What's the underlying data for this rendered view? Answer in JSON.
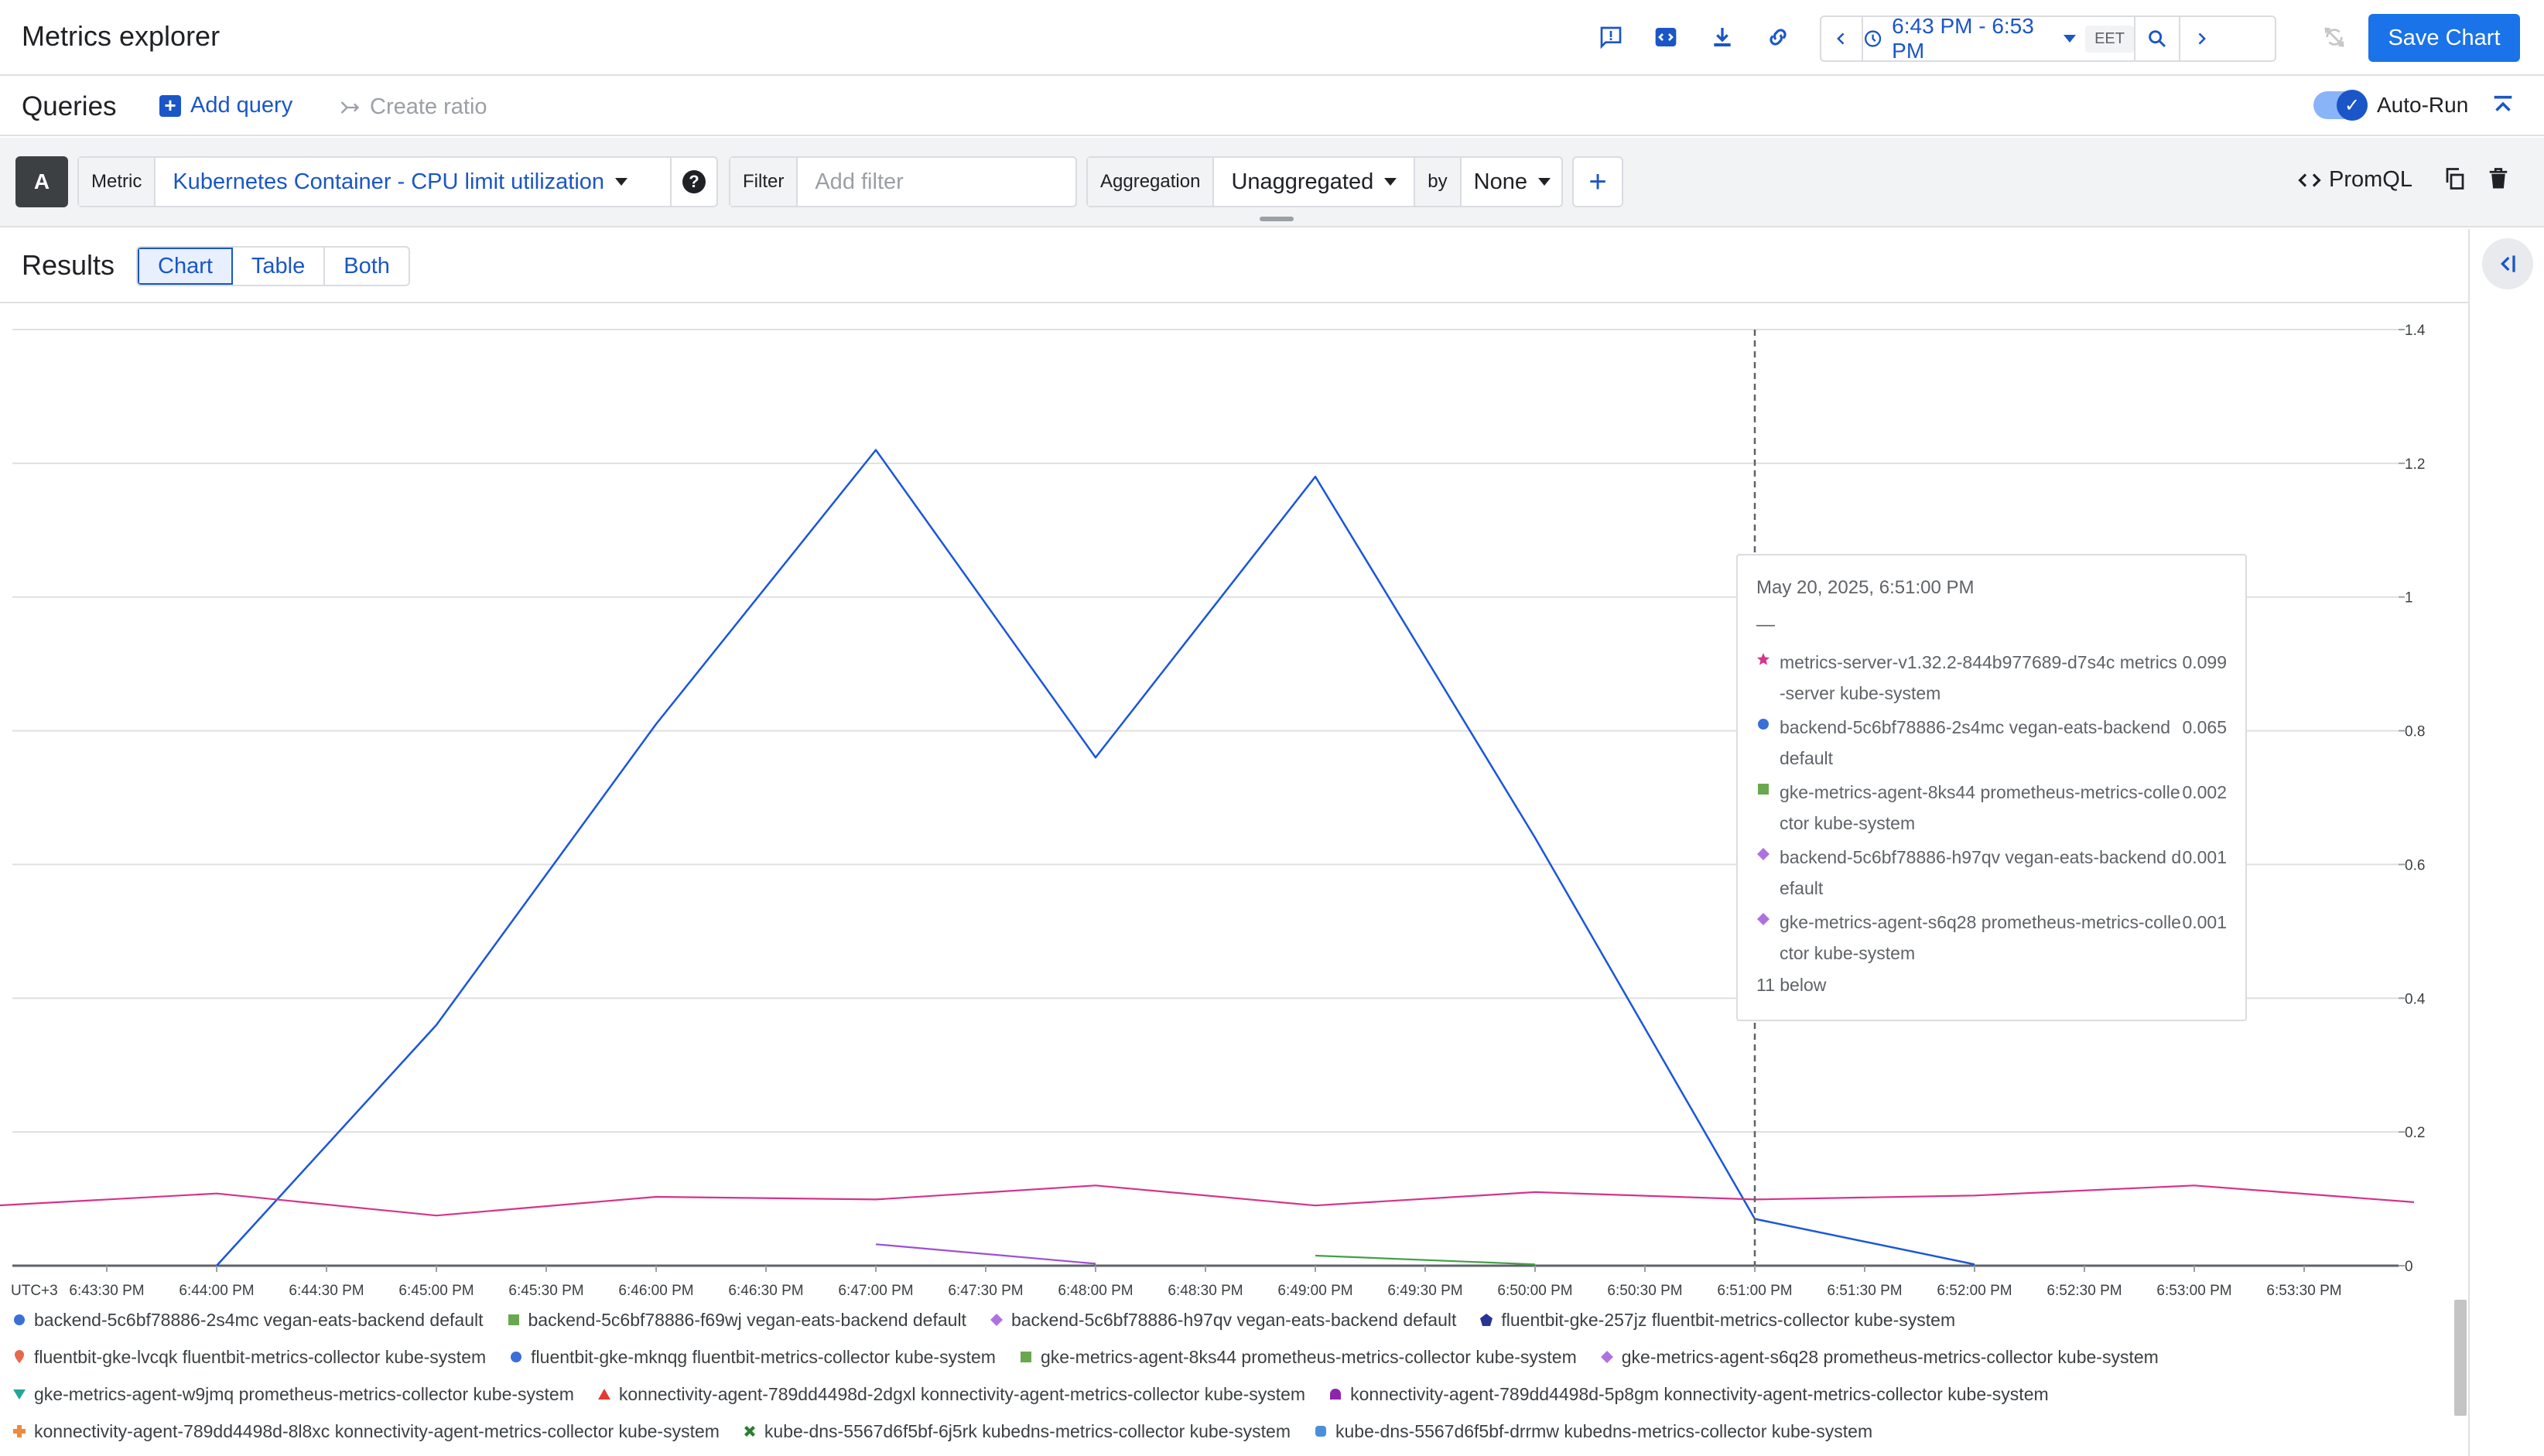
{
  "app": {
    "title": "Metrics explorer",
    "save_label": "Save Chart",
    "time_range": "6:43 PM - 6:53 PM",
    "timezone": "EET",
    "accent_color": "#1a73e8"
  },
  "queries": {
    "title": "Queries",
    "add_query_label": "Add query",
    "create_ratio_label": "Create ratio",
    "autorun_label": "Auto-Run",
    "autorun_enabled": true
  },
  "query_a": {
    "letter": "A",
    "metric_label": "Metric",
    "metric_value": "Kubernetes Container - CPU limit utilization",
    "filter_label": "Filter",
    "filter_placeholder": "Add filter",
    "aggregation_label": "Aggregation",
    "aggregation_value": "Unaggregated",
    "by_label": "by",
    "by_value": "None",
    "promql_label": "PromQL"
  },
  "results": {
    "title": "Results",
    "views": [
      "Chart",
      "Table",
      "Both"
    ],
    "active_view": "Chart"
  },
  "chart_data": {
    "type": "line",
    "xlabel_prefix": "UTC+3",
    "x": [
      "6:43:30 PM",
      "6:44:00 PM",
      "6:44:30 PM",
      "6:45:00 PM",
      "6:45:30 PM",
      "6:46:00 PM",
      "6:46:30 PM",
      "6:47:00 PM",
      "6:47:30 PM",
      "6:48:00 PM",
      "6:48:30 PM",
      "6:49:00 PM",
      "6:49:30 PM",
      "6:50:00 PM",
      "6:50:30 PM",
      "6:51:00 PM",
      "6:51:30 PM",
      "6:52:00 PM",
      "6:52:30 PM",
      "6:53:00 PM",
      "6:53:30 PM"
    ],
    "yticks": [
      "0",
      "0.2",
      "0.4",
      "0.6",
      "0.8",
      "1",
      "1.2",
      "1.4"
    ],
    "ylim": [
      0,
      1.4
    ],
    "grid": true,
    "cursor_x": "6:51:00 PM",
    "series": [
      {
        "name": "backend-5c6bf78886-2s4mc vegan-eats-backend default",
        "color": "#1a56db",
        "points": [
          [
            "6:44:00 PM",
            0
          ],
          [
            "6:45:00 PM",
            0.36
          ],
          [
            "6:46:00 PM",
            0.81
          ],
          [
            "6:47:00 PM",
            1.22
          ],
          [
            "6:48:00 PM",
            0.76
          ],
          [
            "6:49:00 PM",
            1.18
          ],
          [
            "6:50:00 PM",
            0.64
          ],
          [
            "6:51:00 PM",
            0.07
          ],
          [
            "6:52:00 PM",
            0.002
          ]
        ]
      },
      {
        "name": "metrics-server-v1.32.2-844b977689-d7s4c metrics-server kube-system",
        "color": "#d6338a",
        "points": [
          [
            "6:43:00 PM",
            0.09
          ],
          [
            "6:44:00 PM",
            0.108
          ],
          [
            "6:45:00 PM",
            0.075
          ],
          [
            "6:46:00 PM",
            0.103
          ],
          [
            "6:47:00 PM",
            0.099
          ],
          [
            "6:48:00 PM",
            0.12
          ],
          [
            "6:49:00 PM",
            0.09
          ],
          [
            "6:50:00 PM",
            0.11
          ],
          [
            "6:51:00 PM",
            0.099
          ],
          [
            "6:52:00 PM",
            0.105
          ],
          [
            "6:53:00 PM",
            0.12
          ],
          [
            "6:54:00 PM",
            0.095
          ]
        ]
      },
      {
        "name": "backend-5c6bf78886-h97qv vegan-eats-backend default",
        "color": "#9c4fd6",
        "points": [
          [
            "6:47:00 PM",
            0.032
          ],
          [
            "6:48:00 PM",
            0.003
          ]
        ]
      },
      {
        "name": "gke-metrics-agent-8ks44 prometheus-metrics-collector kube-system",
        "color": "#43a047",
        "points": [
          [
            "6:49:00 PM",
            0.015
          ],
          [
            "6:50:00 PM",
            0.002
          ]
        ]
      }
    ]
  },
  "tooltip": {
    "date": "May 20, 2025, 6:51:00 PM",
    "dash": "—",
    "items": [
      {
        "name": "metrics-server-v1.32.2-844b977689-d7s4c metrics-server kube-system",
        "value": "0.099",
        "marker": "star",
        "color": "#d6338a"
      },
      {
        "name": "backend-5c6bf78886-2s4mc vegan-eats-backend default",
        "value": "0.065",
        "marker": "circle",
        "color": "#3a6fd8"
      },
      {
        "name": "gke-metrics-agent-8ks44 prometheus-metrics-collector kube-system",
        "value": "0.002",
        "marker": "square",
        "color": "#6aa84f"
      },
      {
        "name": "backend-5c6bf78886-h97qv vegan-eats-backend default",
        "value": "0.001",
        "marker": "diamond",
        "color": "#b071e0"
      },
      {
        "name": "gke-metrics-agent-s6q28 prometheus-metrics-collector kube-system",
        "value": "0.001",
        "marker": "diamond",
        "color": "#b071e0"
      }
    ],
    "more": "11 below"
  },
  "legend": {
    "rows": [
      [
        {
          "name": "backend-5c6bf78886-2s4mc vegan-eats-backend default",
          "marker": "circle",
          "color": "#3a6fd8"
        },
        {
          "name": "backend-5c6bf78886-f69wj vegan-eats-backend default",
          "marker": "square",
          "color": "#6aa84f"
        },
        {
          "name": "backend-5c6bf78886-h97qv vegan-eats-backend default",
          "marker": "diamond",
          "color": "#b071e0"
        },
        {
          "name": "fluentbit-gke-257jz fluentbit-metrics-collector kube-system",
          "marker": "pentagon",
          "color": "#283593"
        }
      ],
      [
        {
          "name": "fluentbit-gke-lvcqk fluentbit-metrics-collector kube-system",
          "marker": "pin",
          "color": "#e8684a"
        },
        {
          "name": "fluentbit-gke-mknqg fluentbit-metrics-collector kube-system",
          "marker": "circle",
          "color": "#3a6fd8"
        },
        {
          "name": "gke-metrics-agent-8ks44 prometheus-metrics-collector kube-system",
          "marker": "square",
          "color": "#6aa84f"
        },
        {
          "name": "gke-metrics-agent-s6q28 prometheus-metrics-collector kube-system",
          "marker": "diamond",
          "color": "#b071e0"
        }
      ],
      [
        {
          "name": "gke-metrics-agent-w9jmq prometheus-metrics-collector kube-system",
          "marker": "triangle-down",
          "color": "#26a69a"
        },
        {
          "name": "konnectivity-agent-789dd4498d-2dgxl konnectivity-agent-metrics-collector kube-system",
          "marker": "triangle",
          "color": "#e53935"
        },
        {
          "name": "konnectivity-agent-789dd4498d-5p8gm konnectivity-agent-metrics-collector kube-system",
          "marker": "semicircle",
          "color": "#8e24aa"
        }
      ],
      [
        {
          "name": "konnectivity-agent-789dd4498d-8l8xc konnectivity-agent-metrics-collector kube-system",
          "marker": "plus",
          "color": "#ef8a3c"
        },
        {
          "name": "kube-dns-5567d6f5bf-6j5rk kubedns-metrics-collector kube-system",
          "marker": "cross",
          "color": "#2e7d32"
        },
        {
          "name": "kube-dns-5567d6f5bf-drrmw kubedns-metrics-collector kube-system",
          "marker": "square-round",
          "color": "#4a90d9"
        }
      ]
    ]
  }
}
